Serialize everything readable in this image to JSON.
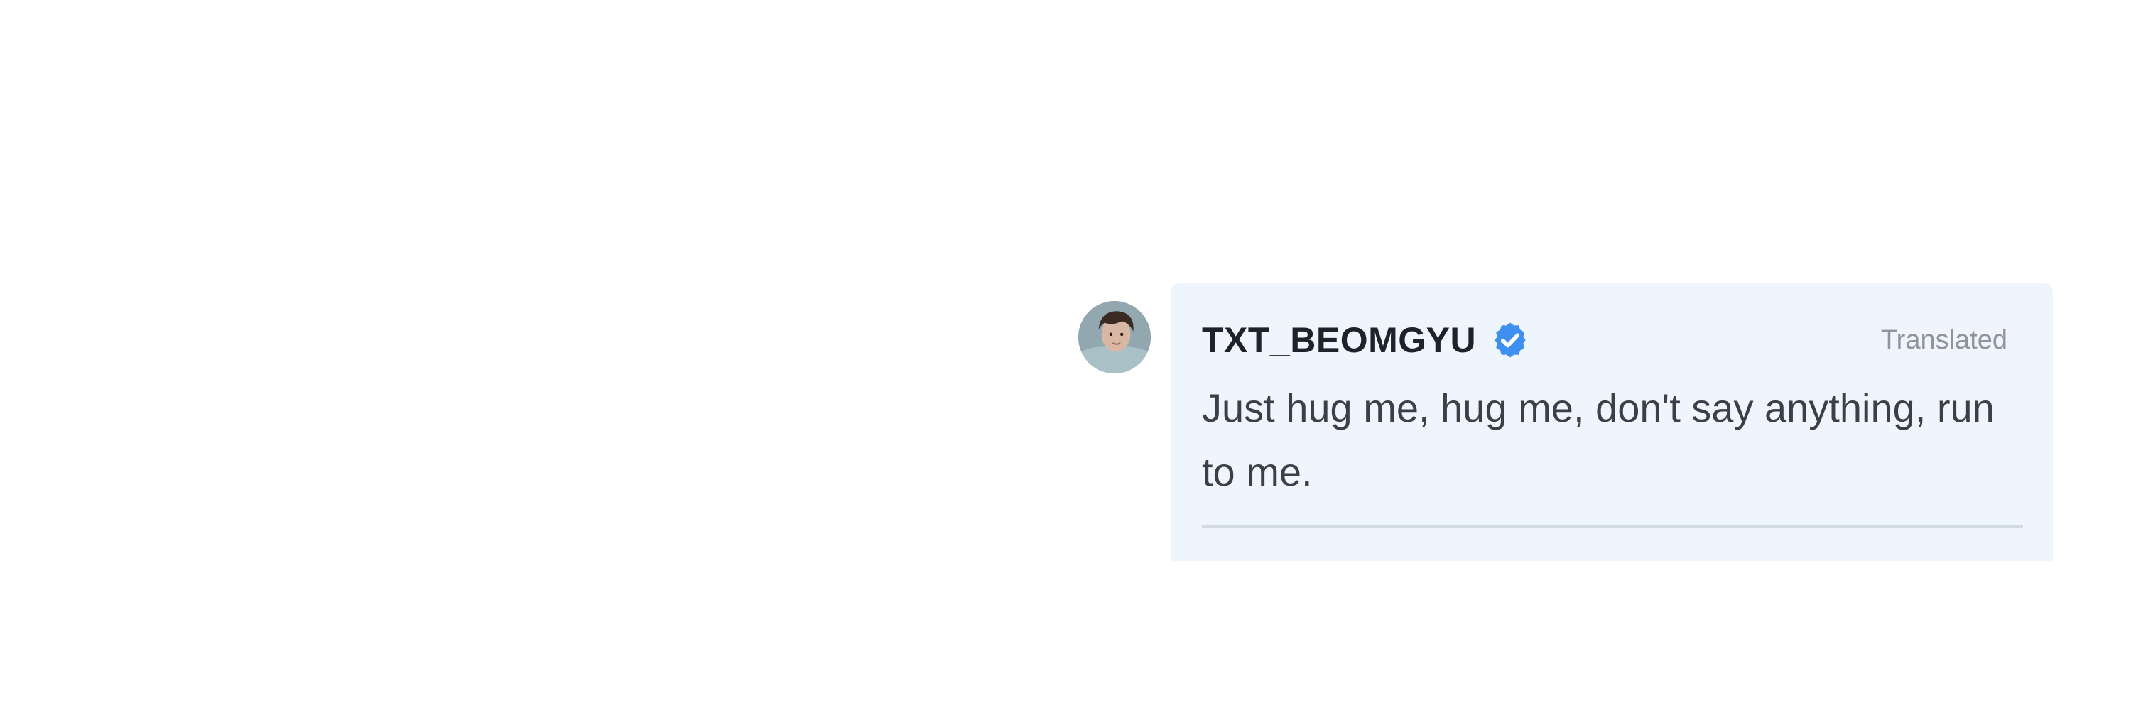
{
  "post": {
    "author": {
      "username": "TXT_BEOMGYU",
      "verified": true,
      "avatar_icon": "profile-photo-avatar"
    },
    "translated_label": "Translated",
    "message": "Just hug me, hug me, don't say anything, run to me."
  },
  "colors": {
    "page_background": "#ffffff",
    "bubble_background": "#eef5fd",
    "verified_badge": "#3f8ff0",
    "username_text": "#1e2329",
    "message_text": "#3a4047",
    "meta_text": "#8e959c",
    "divider": "#d3dbe3"
  },
  "icons": {
    "verified": "verified-badge-icon"
  }
}
